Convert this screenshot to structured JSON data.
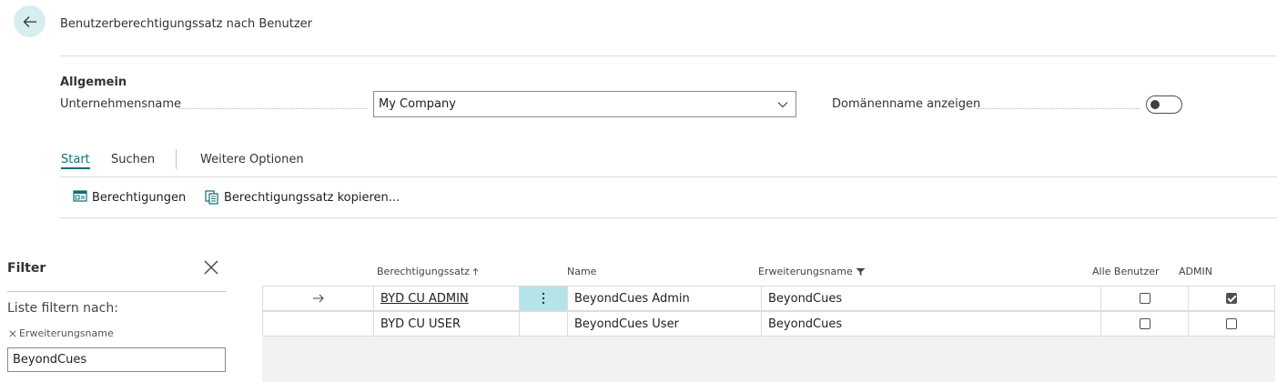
{
  "header": {
    "title": "Benutzerberechtigungssatz nach Benutzer"
  },
  "general": {
    "group_title": "Allgemein",
    "company_label": "Unternehmensname",
    "company_value": "My Company",
    "domain_label": "Domänenname anzeigen",
    "domain_toggle_on": false
  },
  "actions": {
    "tabs": [
      {
        "label": "Start",
        "active": true
      },
      {
        "label": "Suchen",
        "active": false
      },
      {
        "label": "Weitere Optionen",
        "active": false
      }
    ],
    "buttons": [
      {
        "label": "Berechtigungen",
        "icon": "permissions-icon"
      },
      {
        "label": "Berechtigungssatz kopieren...",
        "icon": "copy-icon"
      }
    ]
  },
  "filter": {
    "title": "Filter",
    "subtitle": "Liste filtern nach:",
    "field_name": "Erweiterungsname",
    "field_value": "BeyondCues"
  },
  "grid": {
    "columns": [
      "Berechtigungssatz",
      "Name",
      "Erweiterungsname",
      "Alle Benutzer",
      "ADMIN"
    ],
    "rows": [
      {
        "set": "BYD CU ADMIN",
        "name": "BeyondCues Admin",
        "extension": "BeyondCues",
        "all_users": false,
        "admin": true,
        "selected": true
      },
      {
        "set": "BYD CU USER",
        "name": "BeyondCues User",
        "extension": "BeyondCues",
        "all_users": false,
        "admin": false,
        "selected": false
      }
    ]
  },
  "colors": {
    "accent": "#0f6f78",
    "back_button_bg": "#d7eef0",
    "selected_cell_bg": "#b4e4ea"
  }
}
